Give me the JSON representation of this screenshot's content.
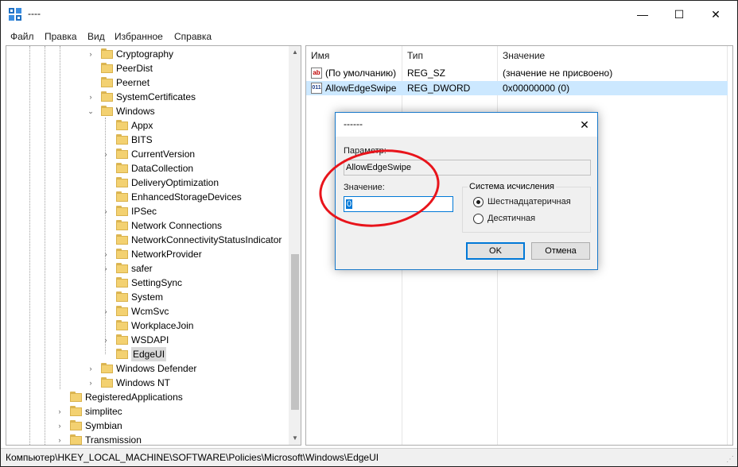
{
  "window": {
    "title": "----",
    "minimize_glyph": "—",
    "maximize_glyph": "☐",
    "close_glyph": "✕"
  },
  "menu": [
    "Файл",
    "Правка",
    "Вид",
    "Избранное",
    "Справка"
  ],
  "tree": {
    "expanded_glyph": "⌄",
    "collapsed_glyph": "›",
    "items": [
      {
        "label": "Cryptography",
        "level": 2,
        "expander": "collapsed"
      },
      {
        "label": "PeerDist",
        "level": 2,
        "expander": "none"
      },
      {
        "label": "Peernet",
        "level": 2,
        "expander": "none"
      },
      {
        "label": "SystemCertificates",
        "level": 2,
        "expander": "collapsed"
      },
      {
        "label": "Windows",
        "level": 2,
        "expander": "expanded"
      },
      {
        "label": "Appx",
        "level": 3,
        "expander": "none"
      },
      {
        "label": "BITS",
        "level": 3,
        "expander": "none"
      },
      {
        "label": "CurrentVersion",
        "level": 3,
        "expander": "collapsed"
      },
      {
        "label": "DataCollection",
        "level": 3,
        "expander": "none"
      },
      {
        "label": "DeliveryOptimization",
        "level": 3,
        "expander": "none"
      },
      {
        "label": "EnhancedStorageDevices",
        "level": 3,
        "expander": "none"
      },
      {
        "label": "IPSec",
        "level": 3,
        "expander": "collapsed"
      },
      {
        "label": "Network Connections",
        "level": 3,
        "expander": "none"
      },
      {
        "label": "NetworkConnectivityStatusIndicator",
        "level": 3,
        "expander": "none"
      },
      {
        "label": "NetworkProvider",
        "level": 3,
        "expander": "collapsed"
      },
      {
        "label": "safer",
        "level": 3,
        "expander": "collapsed"
      },
      {
        "label": "SettingSync",
        "level": 3,
        "expander": "none"
      },
      {
        "label": "System",
        "level": 3,
        "expander": "none"
      },
      {
        "label": "WcmSvc",
        "level": 3,
        "expander": "collapsed"
      },
      {
        "label": "WorkplaceJoin",
        "level": 3,
        "expander": "none"
      },
      {
        "label": "WSDAPI",
        "level": 3,
        "expander": "collapsed"
      },
      {
        "label": "EdgeUI",
        "level": 3,
        "expander": "none",
        "selected": true
      },
      {
        "label": "Windows Defender",
        "level": 2,
        "expander": "collapsed"
      },
      {
        "label": "Windows NT",
        "level": 2,
        "expander": "collapsed"
      },
      {
        "label": "RegisteredApplications",
        "level": 1,
        "expander": "none"
      },
      {
        "label": "simplitec",
        "level": 1,
        "expander": "collapsed"
      },
      {
        "label": "Symbian",
        "level": 1,
        "expander": "collapsed"
      },
      {
        "label": "Transmission",
        "level": 1,
        "expander": "collapsed"
      }
    ]
  },
  "list": {
    "columns": [
      "Имя",
      "Тип",
      "Значение"
    ],
    "rows": [
      {
        "icon": "ab",
        "name": "(По умолчанию)",
        "type": "REG_SZ",
        "value": "(значение не присвоено)",
        "selected": false
      },
      {
        "icon": "011",
        "name": "AllowEdgeSwipe",
        "type": "REG_DWORD",
        "value": "0x00000000 (0)",
        "selected": true
      }
    ]
  },
  "status_path": "Компьютер\\HKEY_LOCAL_MACHINE\\SOFTWARE\\Policies\\Microsoft\\Windows\\EdgeUI",
  "dialog": {
    "title": "------",
    "close_glyph": "✕",
    "param_label": "Параметр:",
    "param_value": "AllowEdgeSwipe",
    "value_label": "Значение:",
    "value": "0",
    "group_title": "Система исчисления",
    "radio_hex": "Шестнадцатеричная",
    "radio_dec": "Десятичная",
    "ok": "OK",
    "cancel": "Отмена"
  },
  "colors": {
    "selection": "#cce8ff",
    "accent": "#0078d7",
    "annotation": "#e8141b",
    "folder": "#f3d171"
  }
}
